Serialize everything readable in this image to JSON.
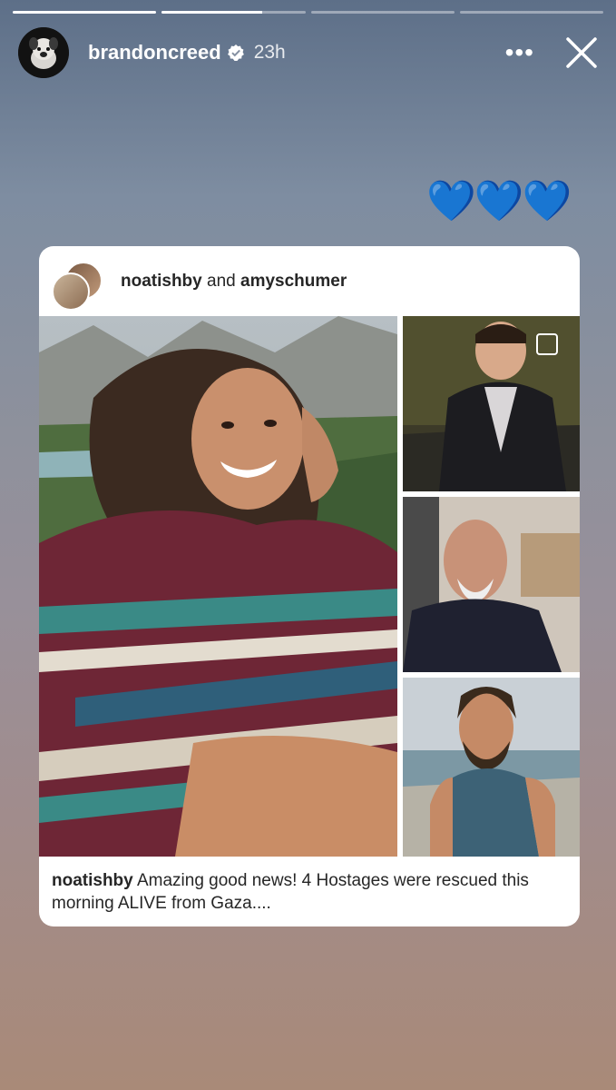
{
  "story": {
    "progress": [
      1,
      0.7,
      0,
      0
    ],
    "username": "brandoncreed",
    "time": "23h",
    "more_icon": "more-dots-icon",
    "close_icon": "close-icon",
    "hearts": "💙💙💙"
  },
  "post": {
    "author1": "noatishby",
    "joiner": "and",
    "author2": "amyschumer",
    "caption_user": "noatishby",
    "caption_text": "Amazing good news! 4 Hostages were rescued this morning ALIVE from Gaza...."
  },
  "colors": {
    "accent_blue": "#2b8af7",
    "card_bg": "#ffffff"
  }
}
